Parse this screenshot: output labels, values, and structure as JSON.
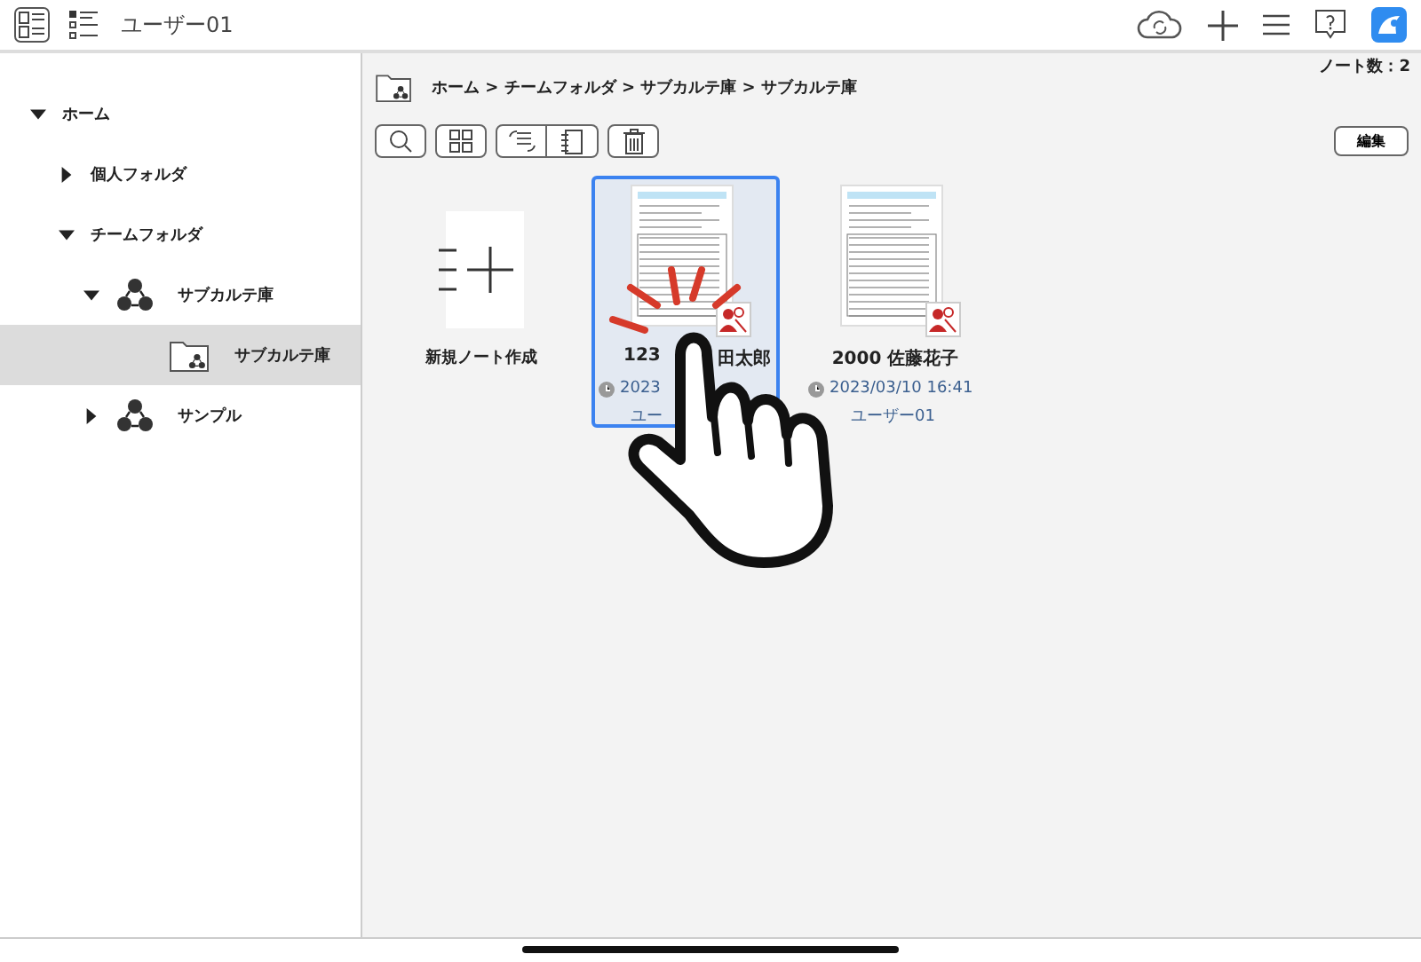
{
  "header": {
    "title": "ユーザー01"
  },
  "tree": [
    {
      "label": "ホーム",
      "expanded": true,
      "selected": false,
      "children": [
        {
          "label": "個人フォルダ",
          "expanded": false,
          "selected": false
        },
        {
          "label": "チームフォルダ",
          "expanded": true,
          "selected": false,
          "children": [
            {
              "label": "サブカルテ庫",
              "kind": "team",
              "expanded": true,
              "selected": false,
              "children": [
                {
                  "label": "サブカルテ庫",
                  "kind": "shared-folder",
                  "selected": true
                }
              ]
            },
            {
              "label": "サンプル",
              "kind": "team",
              "expanded": false,
              "selected": false
            }
          ]
        }
      ]
    }
  ],
  "breadcrumb": "ホーム > チームフォルダ > サブカルテ庫 > サブカルテ庫",
  "note_count": "ノート数：2",
  "edit_button": "編集",
  "new_note": {
    "label": "新規ノート作成"
  },
  "notes": [
    {
      "title_parts": [
        "123",
        "田太郎"
      ],
      "date": "2023",
      "user": "ユー",
      "selected": true
    },
    {
      "title_parts": [
        "2000 佐藤花子"
      ],
      "date": "2023/03/10 16:41",
      "user": "ユーザー01",
      "selected": false
    }
  ]
}
